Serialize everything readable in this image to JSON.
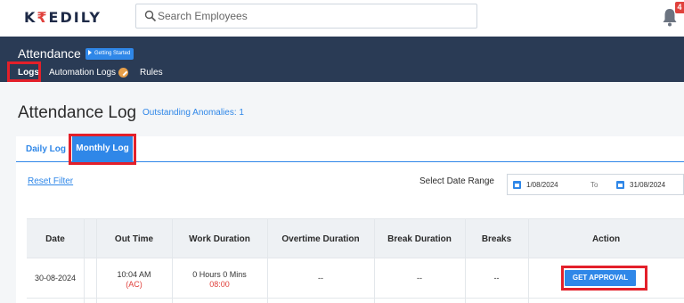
{
  "header": {
    "logo_prefix": "K",
    "logo_accent": "₹",
    "logo_suffix": "EDILY",
    "search_placeholder": "Search Employees",
    "notification_count": "4"
  },
  "subnav": {
    "title": "Attendance",
    "getting_started": "Getting Started",
    "tabs": [
      "Logs",
      "Automation Logs",
      "Rules"
    ]
  },
  "page": {
    "heading": "Attendance Log",
    "anomalies": "Outstanding Anomalies: 1"
  },
  "log_tabs": {
    "daily": "Daily Log",
    "monthly": "Monthly Log"
  },
  "filters": {
    "reset": "Reset Filter",
    "range_label": "Select Date Range",
    "from": "1/08/2024",
    "to_label": "To",
    "to": "31/08/2024"
  },
  "table": {
    "headers": [
      "Date",
      "Out Time",
      "Work Duration",
      "Overtime Duration",
      "Break Duration",
      "Breaks",
      "Action"
    ],
    "row": {
      "date": "30-08-2024",
      "out_time": "10:04 AM",
      "out_tag": "(AC)",
      "work_duration": "0 Hours 0 Mins",
      "work_sub": "08:00",
      "overtime": "--",
      "break_duration": "--",
      "breaks": "--",
      "action": "GET APPROVAL"
    }
  },
  "colors": {
    "accent": "#2f87e8",
    "nav": "#2a3b55",
    "highlight": "#e3202a",
    "brand_red": "#e0413c"
  },
  "icons": [
    "search-icon",
    "bell-icon",
    "play-icon",
    "check-badge-icon",
    "calendar-icon"
  ]
}
